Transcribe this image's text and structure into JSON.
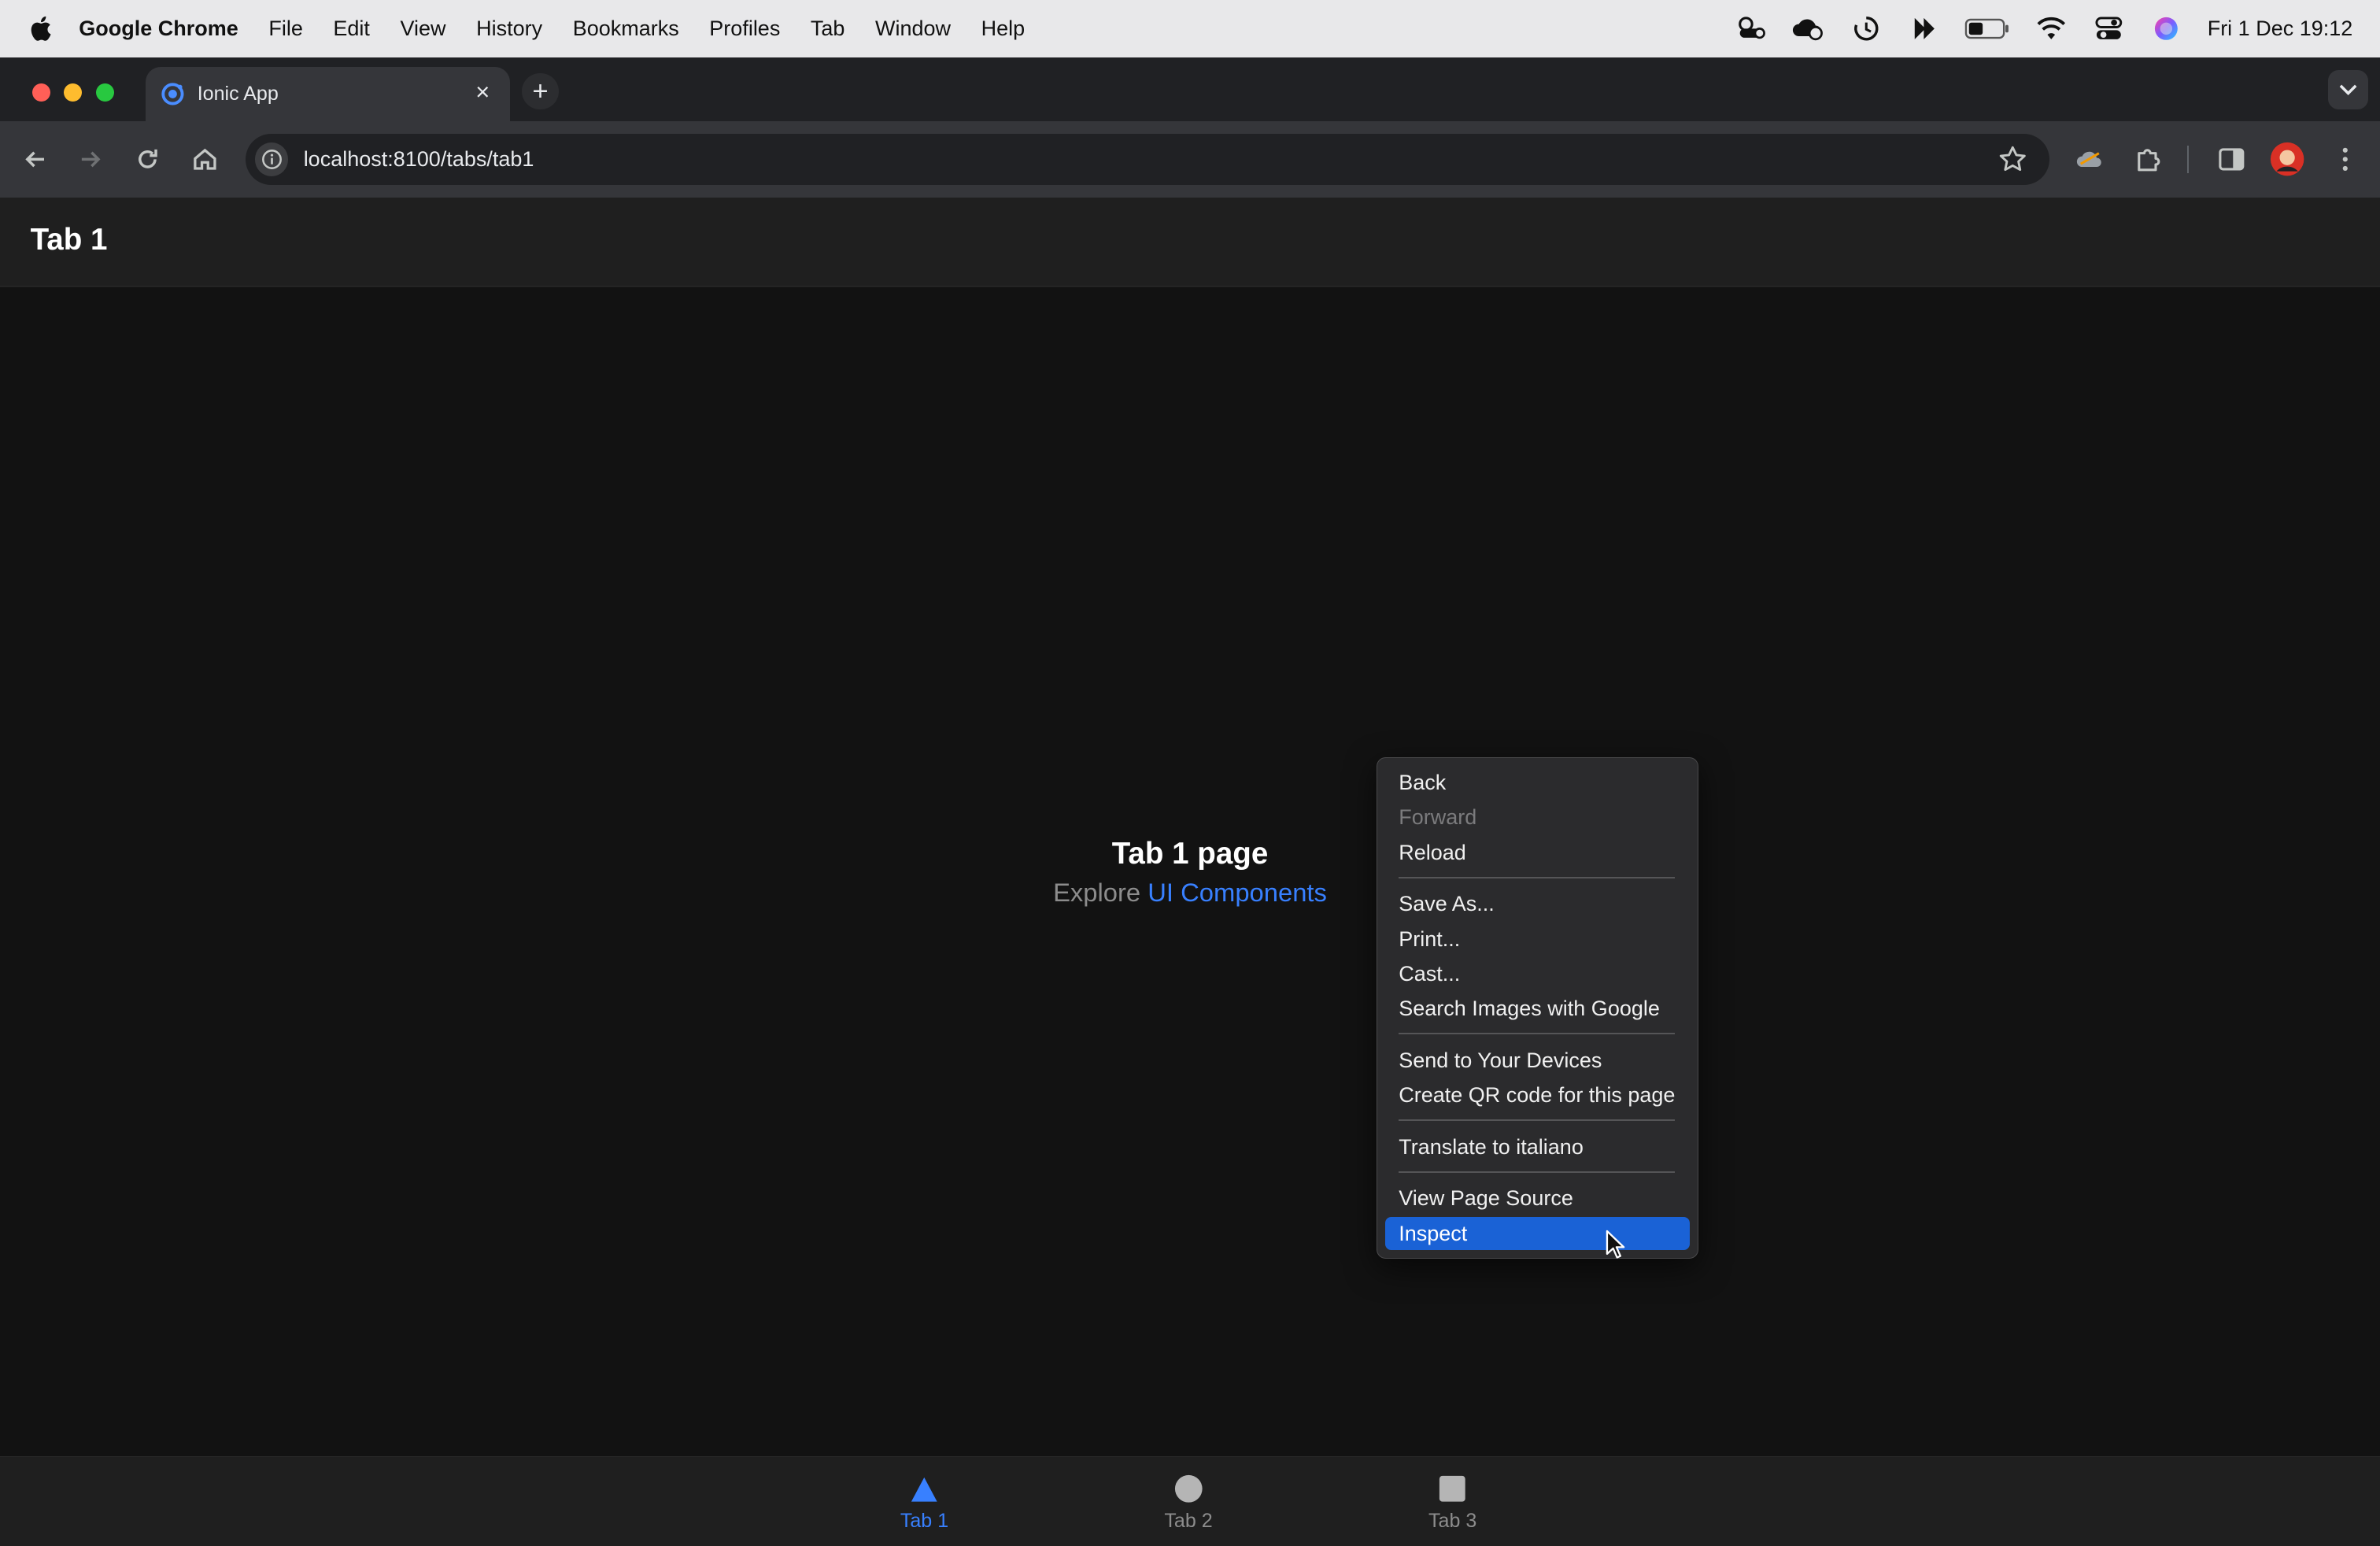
{
  "menubar": {
    "app_name": "Google Chrome",
    "items": [
      "File",
      "Edit",
      "View",
      "History",
      "Bookmarks",
      "Profiles",
      "Tab",
      "Window",
      "Help"
    ],
    "clock": "Fri 1 Dec  19:12"
  },
  "browser": {
    "tab_title": "Ionic App",
    "url": "localhost:8100/tabs/tab1"
  },
  "app": {
    "header_title": "Tab 1",
    "page_heading": "Tab 1 page",
    "explore_prefix": "Explore ",
    "explore_link": "UI Components",
    "accent": "#3880ff"
  },
  "context_menu": {
    "items": [
      {
        "label": "Back",
        "disabled": false
      },
      {
        "label": "Forward",
        "disabled": true
      },
      {
        "label": "Reload",
        "disabled": false
      },
      {
        "label": "Save As...",
        "disabled": false
      },
      {
        "label": "Print...",
        "disabled": false
      },
      {
        "label": "Cast...",
        "disabled": false
      },
      {
        "label": "Search Images with Google",
        "disabled": false
      },
      {
        "label": "Send to Your Devices",
        "disabled": false
      },
      {
        "label": "Create QR code for this page",
        "disabled": false
      },
      {
        "label": "Translate to italiano",
        "disabled": false
      },
      {
        "label": "View Page Source",
        "disabled": false
      },
      {
        "label": "Inspect",
        "disabled": false,
        "highlighted": true
      }
    ]
  },
  "tabbar": {
    "tabs": [
      {
        "label": "Tab 1",
        "icon": "triangle-icon",
        "active": true
      },
      {
        "label": "Tab 2",
        "icon": "ellipse-icon",
        "active": false
      },
      {
        "label": "Tab 3",
        "icon": "square-icon",
        "active": false
      }
    ]
  }
}
